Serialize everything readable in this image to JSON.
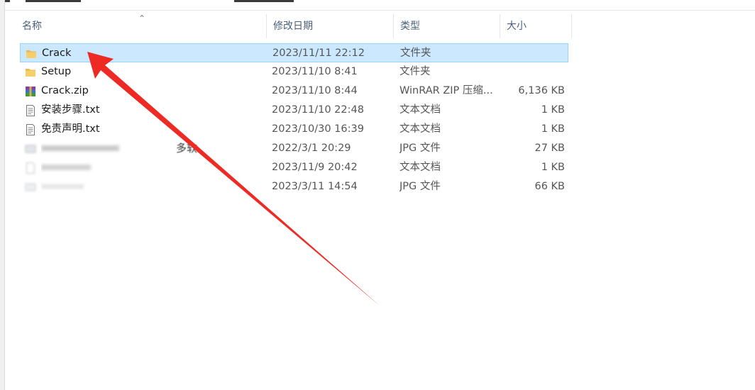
{
  "columns": {
    "name": "名称",
    "modified": "修改日期",
    "type": "类型",
    "size": "大小"
  },
  "files": [
    {
      "name": "Crack",
      "modified": "2023/11/11 22:12",
      "type": "文件夹",
      "size": "",
      "icon": "folder-icon",
      "selected": true
    },
    {
      "name": "Setup",
      "modified": "2023/11/10 8:41",
      "type": "文件夹",
      "size": "",
      "icon": "folder-icon"
    },
    {
      "name": "Crack.zip",
      "modified": "2023/11/10 8:44",
      "type": "WinRAR ZIP 压缩...",
      "size": "6,136 KB",
      "icon": "winrar-archive-icon"
    },
    {
      "name": "安装步骤.txt",
      "modified": "2023/11/10 22:48",
      "type": "文本文档",
      "size": "1 KB",
      "icon": "text-file-icon"
    },
    {
      "name": "免责声明.txt",
      "modified": "2023/10/30 16:39",
      "type": "文本文档",
      "size": "1 KB",
      "icon": "text-file-icon"
    },
    {
      "name": "",
      "modified": "2022/3/1 20:29",
      "type": "JPG 文件",
      "size": "27 KB",
      "icon": "image-file-icon",
      "blurred": true
    },
    {
      "name": "",
      "modified": "2023/11/9 20:42",
      "type": "文本文档",
      "size": "1 KB",
      "icon": "text-file-icon",
      "blurred": true
    },
    {
      "name": "",
      "modified": "2023/3/11 14:54",
      "type": "JPG 文件",
      "size": "66 KB",
      "icon": "image-file-icon",
      "blurred": true
    }
  ],
  "overlay_fragment": "多软",
  "colors": {
    "selection_bg": "#cce8ff",
    "selection_border": "#99d1ff",
    "header_text": "#4c607a",
    "arrow": "#ee2a24",
    "folder": "#e8b84a"
  }
}
